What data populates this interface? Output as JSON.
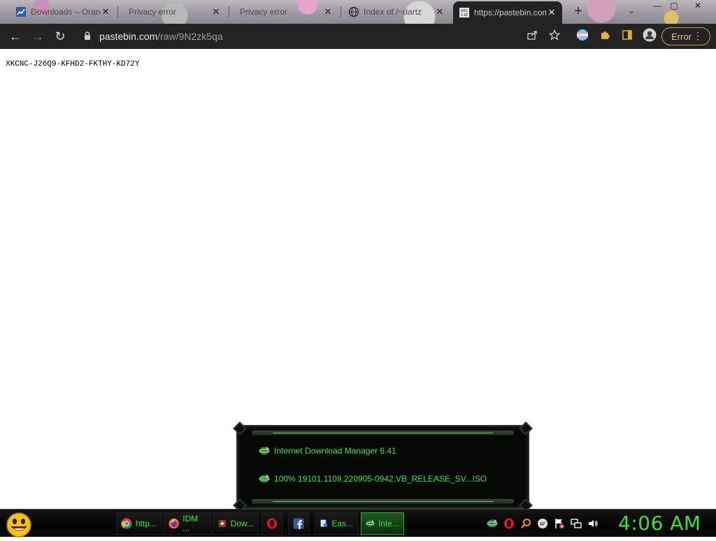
{
  "browser": {
    "tabs": [
      {
        "title": "Downloads – Orange",
        "favicon": "orange-chart-icon",
        "close_glyph": "✕"
      },
      {
        "title": "Privacy error",
        "favicon": "none",
        "close_glyph": "✕"
      },
      {
        "title": "Privacy error",
        "favicon": "none",
        "close_glyph": "✕"
      },
      {
        "title": "Index of /~dartz",
        "favicon": "globe-icon",
        "close_glyph": "✕"
      },
      {
        "title": "https://pastebin.com",
        "favicon": "pastebin-icon",
        "close_glyph": "✕",
        "active": true
      }
    ],
    "new_tab_glyph": "+",
    "tab_search_glyph": "⌄",
    "window_controls": {
      "minimize": "—",
      "maximize": "▢",
      "close": "✕"
    },
    "toolbar": {
      "back_glyph": "←",
      "forward_glyph": "→",
      "reload_glyph": "↻",
      "url_host": "pastebin.com",
      "url_path": "/raw/9N2zk5qa",
      "error_label": "Error",
      "menu_glyph": "⋮"
    }
  },
  "page": {
    "raw_text": "XKCNC-J26Q9-KFHD2-FKTHY-KD72Y"
  },
  "idm_notification": {
    "title": "Internet Download Manager 6.41",
    "progress_line": "100% 19101.1109.220905-0942.VB_RELEASE_SV...ISO"
  },
  "taskbar": {
    "tasks": [
      {
        "label": "http...",
        "icon": "chrome-icon"
      },
      {
        "label": "IDM ...",
        "icon": "firefox-icon"
      },
      {
        "label": "Dow...",
        "icon": "download-icon"
      },
      {
        "label": "",
        "icon": "opera-icon"
      },
      {
        "label": "",
        "icon": "facebook-icon"
      },
      {
        "label": "Eas...",
        "icon": "app-icon"
      },
      {
        "label": "Inte...",
        "icon": "idm-icon",
        "active": true
      }
    ],
    "clock": "4:06 AM"
  },
  "colors": {
    "accent_green": "#3ee03e",
    "toolbar_bg": "#232323",
    "error_chip": "#f0c27a"
  }
}
